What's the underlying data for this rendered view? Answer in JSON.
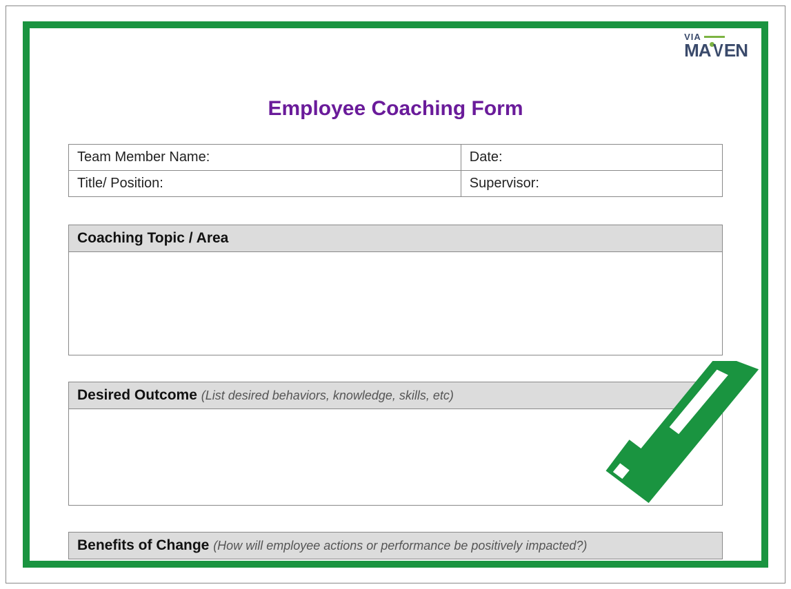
{
  "logo": {
    "top": "VIA",
    "bottom_left": "MA",
    "bottom_right": "EN"
  },
  "title": "Employee Coaching Form",
  "info": {
    "team_member_label": "Team Member Name:",
    "date_label": "Date:",
    "title_position_label": "Title/ Position:",
    "supervisor_label": "Supervisor:"
  },
  "sections": {
    "coaching_topic": {
      "header": "Coaching Topic / Area"
    },
    "desired_outcome": {
      "header": "Desired Outcome ",
      "subtext": "(List desired behaviors, knowledge, skills, etc)"
    },
    "benefits": {
      "header": "Benefits of Change ",
      "subtext": "(How will employee actions or performance be positively impacted?)"
    }
  }
}
